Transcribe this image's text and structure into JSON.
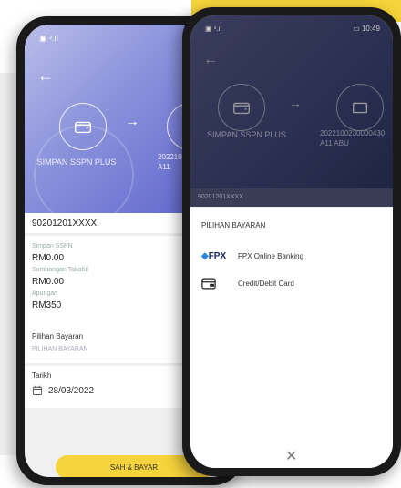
{
  "phone1": {
    "status": "▣ ᵌ.ıl",
    "back_icon": "←",
    "from_label": "SIMPAN SSPN PLUS",
    "to_label_line1": "2022100",
    "to_label_line2": "A11",
    "account": "90201201XXXX",
    "simpan_label": "Simpan SSPN",
    "simpan_value": "RM0.00",
    "takaful_label": "Sumbangan Takaful",
    "takaful_value": "RM0.00",
    "apungan_label": "Apungan",
    "apungan_value": "RM350",
    "pilihan_label": "Pilihan Bayaran",
    "pilihan_placeholder": "PILIHAN BAYARAN",
    "tarikh_label": "Tarikh",
    "tarikh_value": "28/03/2022",
    "button_label": "SAH & BAYAR"
  },
  "phone2": {
    "status": "▣ ᵌ.ıl",
    "time": "▭ 10:49",
    "back_icon": "←",
    "from_label": "SIMPAN SSPN PLUS",
    "to_label_line1": "2022100230000430",
    "to_label_line2": "A11 ABU",
    "account": "90201201XXXX",
    "sheet_title": "PILIHAN BAYARAN",
    "options": [
      {
        "label": "FPX Online Banking",
        "icon": "fpx-logo"
      },
      {
        "label": "Credit/Debit Card",
        "icon": "card-icon"
      }
    ],
    "close_icon": "✕"
  },
  "colors": {
    "accent_yellow": "#f5d33a",
    "hero_purple": "#7d84d6",
    "dim_hero": "#2a2e50"
  }
}
